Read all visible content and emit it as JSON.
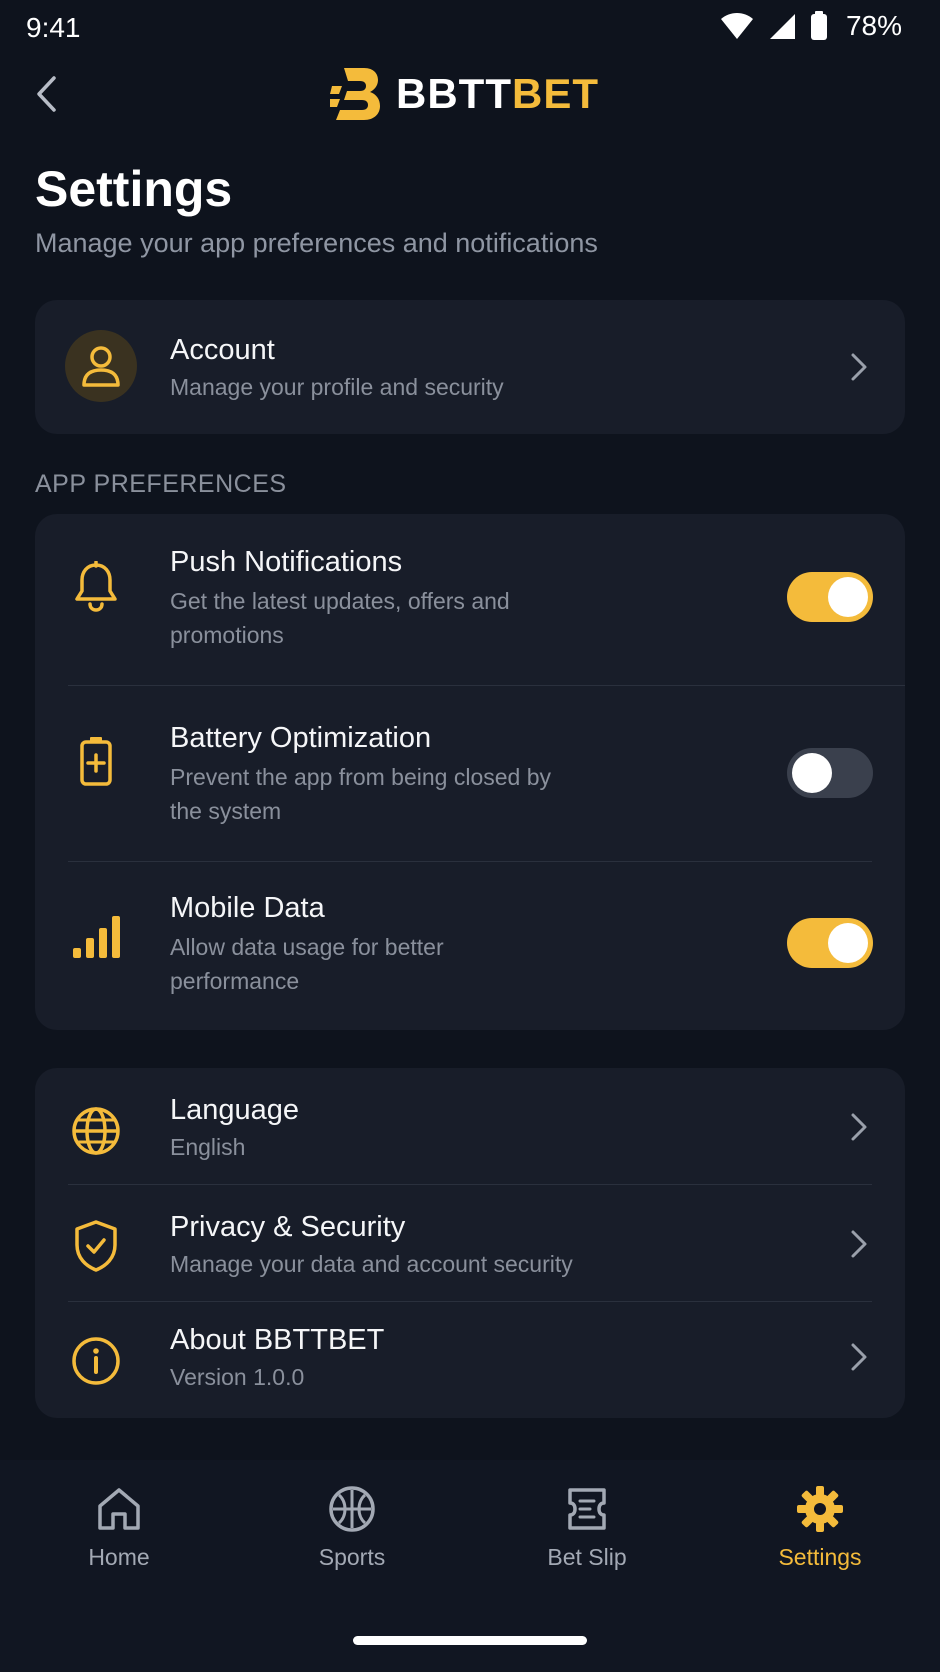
{
  "status_bar": {
    "time": "9:41",
    "battery": "78%"
  },
  "header": {
    "logo_white": "BBTT",
    "logo_yellow": "BET"
  },
  "page": {
    "title": "Settings",
    "subtitle": "Manage your app preferences and notifications"
  },
  "account": {
    "label": "Account",
    "description": "Manage your profile and security"
  },
  "preferences": {
    "section_label": "APP PREFERENCES",
    "items": [
      {
        "label": "Push Notifications",
        "description": "Get the latest updates, offers and promotions",
        "enabled": true
      },
      {
        "label": "Battery Optimization",
        "description": "Prevent the app from being closed by the system",
        "enabled": false
      },
      {
        "label": "Mobile Data",
        "description": "Allow data usage for better performance",
        "enabled": true
      }
    ]
  },
  "general": {
    "items": [
      {
        "label": "Language",
        "value": "English"
      },
      {
        "label": "Privacy & Security",
        "value": "Manage your data and account security"
      },
      {
        "label": "About BBTTBET",
        "value": "Version 1.0.0"
      }
    ]
  },
  "bottom_nav": {
    "items": [
      {
        "label": "Home",
        "icon": "home-icon"
      },
      {
        "label": "Sports",
        "icon": "ball-icon"
      },
      {
        "label": "Bet Slip",
        "icon": "ticket-icon"
      },
      {
        "label": "Settings",
        "icon": "gear-icon",
        "active": true
      }
    ]
  },
  "colors": {
    "accent": "#f4bb3b",
    "background": "#0e131d",
    "card": "#181d29",
    "muted_text": "#8a909c"
  }
}
